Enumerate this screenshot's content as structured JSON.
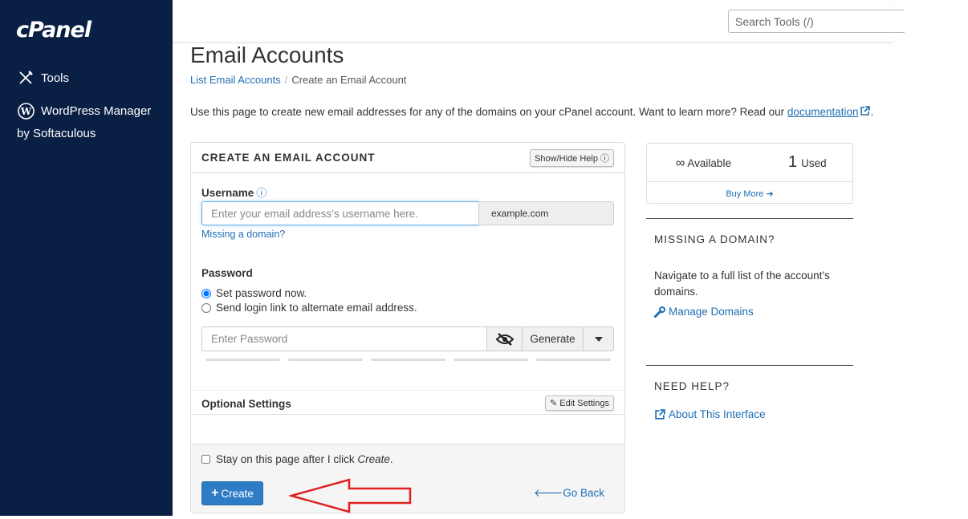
{
  "sidebar": {
    "logo": "cPanel",
    "items": [
      {
        "label": "Tools",
        "icon": "tools-icon"
      },
      {
        "label": "WordPress Manager",
        "sub": "by Softaculous",
        "icon": "wordpress-icon"
      }
    ]
  },
  "topbar": {
    "search_placeholder": "Search Tools (/)"
  },
  "page": {
    "title": "Email Accounts",
    "breadcrumb": {
      "link": "List Email Accounts",
      "sep": "/",
      "current": "Create an Email Account"
    },
    "intro_text": "Use this page to create new email addresses for any of the domains on your cPanel account. Want to learn more? Read our",
    "intro_link": "documentation",
    "intro_end": "."
  },
  "form": {
    "title": "CREATE AN EMAIL ACCOUNT",
    "show_hide_help": "Show/Hide Help",
    "username_label": "Username",
    "username_placeholder": "Enter your email address’s username here.",
    "domain": "example.com",
    "missing_domain": "Missing a domain?",
    "password_label": "Password",
    "radio_set_now": "Set password now.",
    "radio_send_link": "Send login link to alternate email address.",
    "password_placeholder": "Enter Password",
    "generate": "Generate",
    "optional_settings": "Optional Settings",
    "edit_settings": "Edit Settings",
    "stay_text": "Stay on this page after I click",
    "stay_em": "Create",
    "stay_end": ".",
    "create": "Create",
    "go_back": "Go Back"
  },
  "stats": {
    "available_symbol": "∞",
    "available_label": "Available",
    "used_count": "1",
    "used_label": "Used",
    "buy_more": "Buy More"
  },
  "missing_domain_section": {
    "title": "MISSING A DOMAIN?",
    "text": "Navigate to a full list of the account’s domains.",
    "link": "Manage Domains"
  },
  "help_section": {
    "title": "NEED HELP?",
    "link": "About This Interface"
  },
  "colors": {
    "sidebar": "#0a1f44",
    "link": "#1f6fb5",
    "primary": "#2d7cc5",
    "annotation_arrow": "#e02020"
  }
}
